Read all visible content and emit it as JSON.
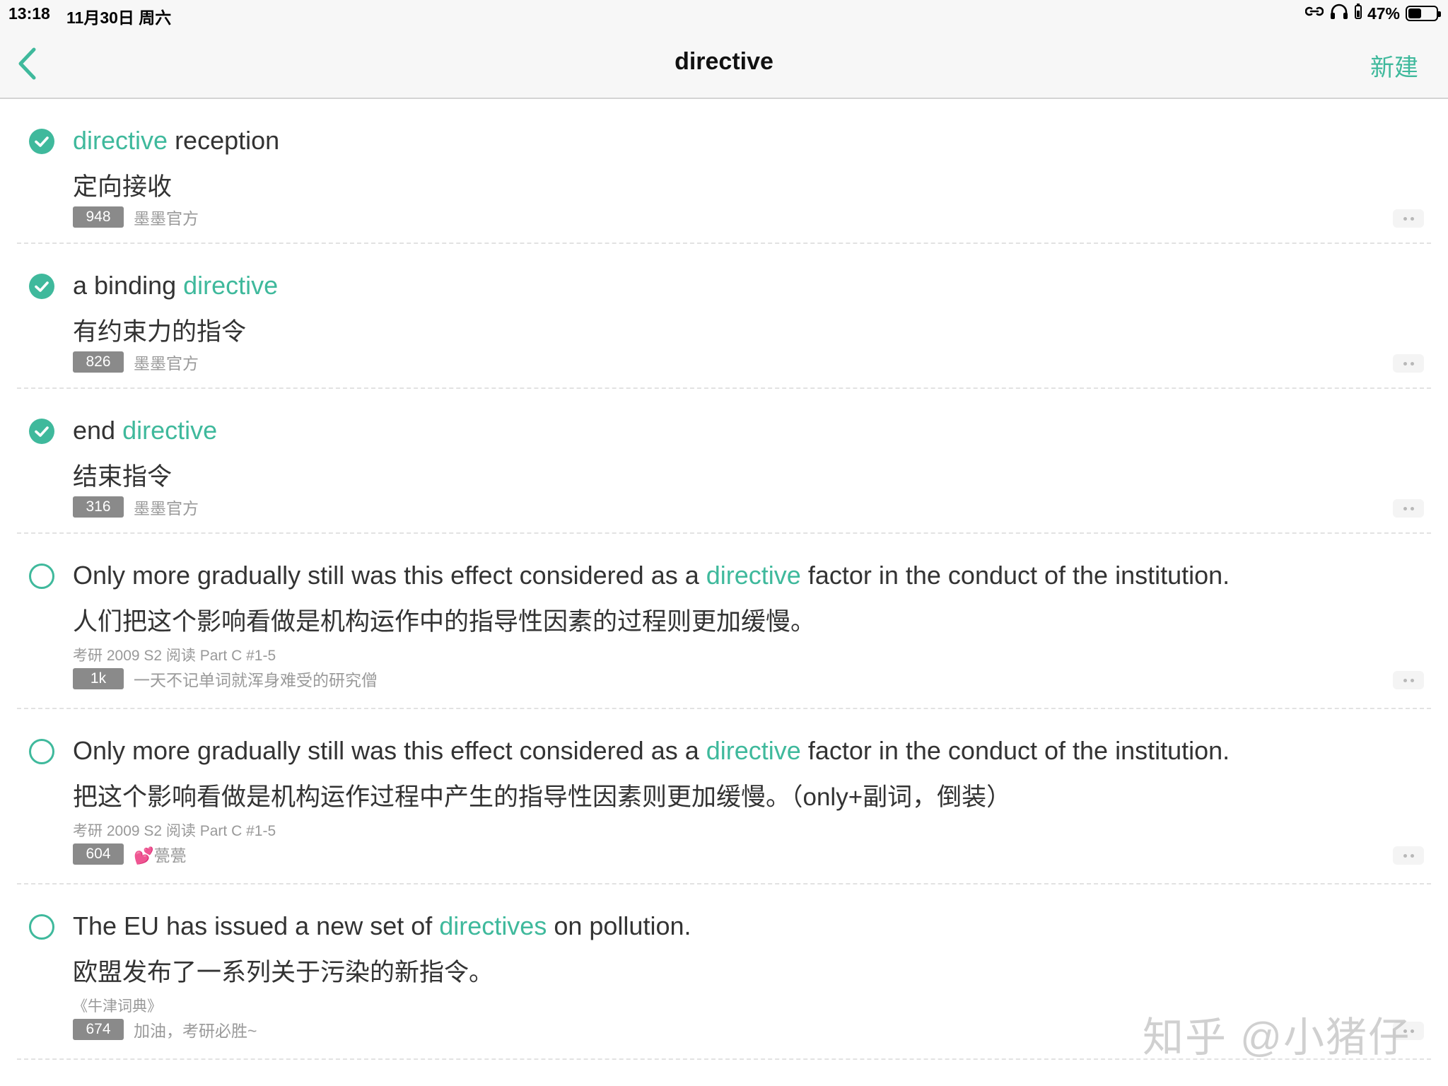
{
  "status_bar": {
    "time": "13:18",
    "date": "11月30日 周六",
    "battery": "47%",
    "battery_level": 0.47,
    "icons": [
      "link-icon",
      "headphones-icon",
      "battery-icon"
    ]
  },
  "nav": {
    "back_icon": "chevron-left-icon",
    "title": "directive",
    "new_label": "新建"
  },
  "accent_color": "#3fb99c",
  "items": [
    {
      "checked": true,
      "en": {
        "before": "",
        "hl": "directive",
        "after": " reception"
      },
      "zh": "定向接收",
      "source": "",
      "count": "948",
      "author": "墨墨官方"
    },
    {
      "checked": true,
      "en": {
        "before": "a binding ",
        "hl": "directive",
        "after": ""
      },
      "zh": "有约束力的指令",
      "source": "",
      "count": "826",
      "author": "墨墨官方"
    },
    {
      "checked": true,
      "en": {
        "before": "end ",
        "hl": "directive",
        "after": ""
      },
      "zh": "结束指令",
      "source": "",
      "count": "316",
      "author": "墨墨官方"
    },
    {
      "checked": false,
      "en": {
        "before": "Only more gradually still was this effect considered as a ",
        "hl": "directive",
        "after": " factor in the conduct of the institution."
      },
      "zh": "人们把这个影响看做是机构运作中的指导性因素的过程则更加缓慢。",
      "source": "考研 2009 S2 阅读 Part C #1-5",
      "count": "1k",
      "author": "一天不记单词就浑身难受的研究僧"
    },
    {
      "checked": false,
      "en": {
        "before": "Only more gradually still was this effect considered as a ",
        "hl": "directive",
        "after": " factor in the conduct of the institution."
      },
      "zh": "把这个影响看做是机构运作过程中产生的指导性因素则更加缓慢。（only+副词，倒装）",
      "source": "考研 2009 S2 阅读 Part C #1-5",
      "count": "604",
      "author": "💕甍甍"
    },
    {
      "checked": false,
      "en": {
        "before": "The EU has issued a new set of ",
        "hl": "directives",
        "after": " on pollution."
      },
      "zh": "欧盟发布了一系列关于污染的新指令。",
      "source": "《牛津词典》",
      "count": "674",
      "author": "加油，考研必胜~"
    }
  ],
  "watermark": "知乎 @小猪仔"
}
